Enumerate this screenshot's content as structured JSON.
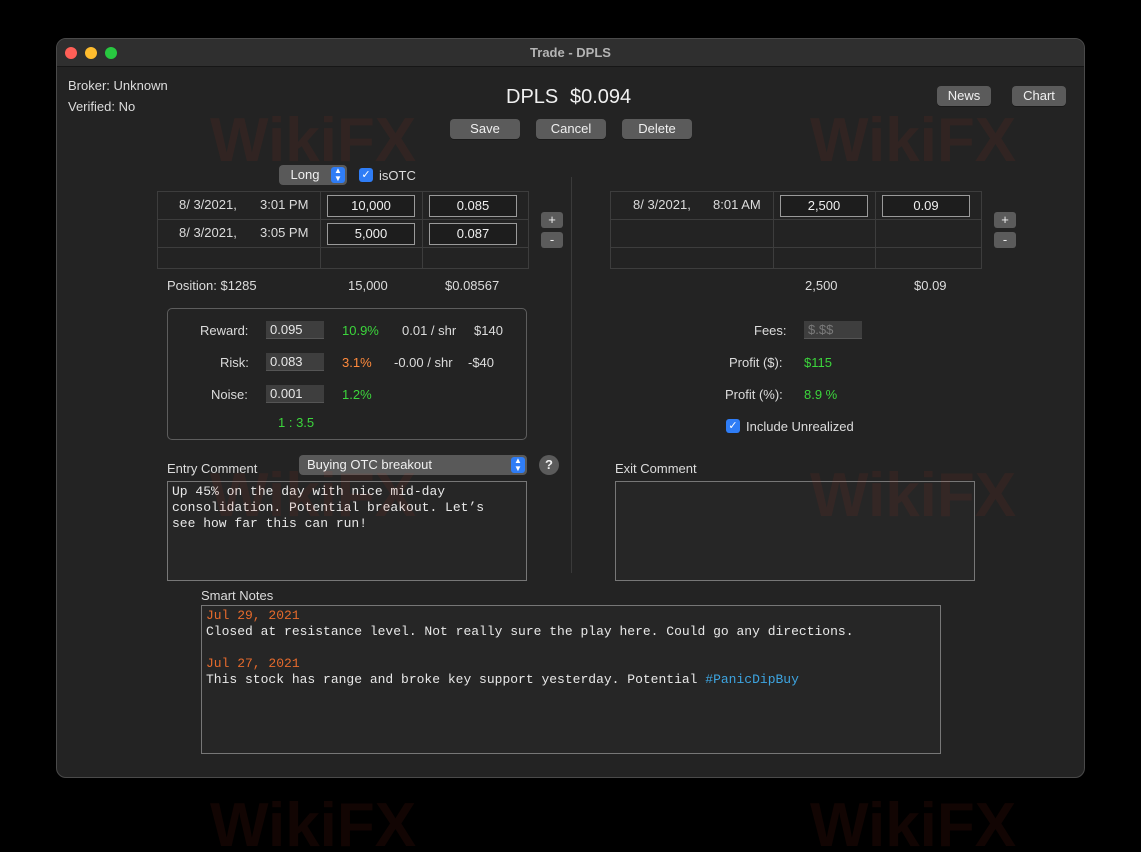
{
  "window": {
    "title": "Trade - DPLS"
  },
  "header": {
    "broker": "Broker: Unknown",
    "verified": "Verified: No",
    "symbol": "DPLS",
    "price": "$0.094",
    "save_label": "Save",
    "cancel_label": "Cancel",
    "delete_label": "Delete",
    "news_label": "News",
    "chart_label": "Chart"
  },
  "entry": {
    "direction": "Long",
    "isotc_label": "isOTC",
    "isotc_checked": true,
    "rows": [
      {
        "date": "8/  3/2021,",
        "time": "3:01 PM",
        "shares": "10,000",
        "price": "0.085"
      },
      {
        "date": "8/  3/2021,",
        "time": "3:05 PM",
        "shares": "5,000",
        "price": "0.087"
      }
    ],
    "position_label": "Position: $1285",
    "total_shares": "15,000",
    "avg_price": "$0.08567",
    "add_label": "+",
    "remove_label": "-"
  },
  "exit": {
    "rows": [
      {
        "date": "8/  3/2021,",
        "time": "8:01 AM",
        "shares": "2,500",
        "price": "0.09"
      }
    ],
    "total_shares": "2,500",
    "avg_price": "$0.09",
    "add_label": "+",
    "remove_label": "-"
  },
  "risk_panel": {
    "reward_label": "Reward:",
    "reward_value": "0.095",
    "reward_pct": "10.9%",
    "reward_per_share": "0.01 / shr",
    "reward_dollars": "$140",
    "risk_label": "Risk:",
    "risk_value": "0.083",
    "risk_pct": "3.1%",
    "risk_per_share": "-0.00 / shr",
    "risk_dollars": "-$40",
    "noise_label": "Noise:",
    "noise_value": "0.001",
    "noise_pct": "1.2%",
    "ratio": "1 : 3.5"
  },
  "results": {
    "fees_label": "Fees:",
    "fees_placeholder": "$.$$",
    "profit_dollars_label": "Profit ($):",
    "profit_dollars_value": "$115",
    "profit_pct_label": "Profit (%):",
    "profit_pct_value": "8.9 %",
    "include_unrealized_label": "Include Unrealized",
    "include_unrealized_checked": true
  },
  "comments": {
    "entry_label": "Entry Comment",
    "entry_preset": "Buying OTC breakout",
    "help_label": "?",
    "entry_text": "Up 45% on the day with nice mid-day\nconsolidation. Potential breakout. Let’s\nsee how far this can run!",
    "exit_label": "Exit Comment",
    "exit_text": ""
  },
  "smart_notes": {
    "label": "Smart Notes",
    "notes": [
      {
        "date": "Jul 29, 2021",
        "text": "Closed at resistance level. Not really sure the play here. Could go any directions."
      },
      {
        "date": "Jul 27, 2021",
        "text": "This stock has range and broke key support yesterday. Potential ",
        "hashtag": "#PanicDipBuy"
      }
    ]
  },
  "watermark": "WikiFX",
  "colors": {
    "window_bg": "#232323",
    "green": "#3cd53c",
    "orange": "#ff8a3c",
    "accent_blue": "#2f7df6",
    "hashtag_blue": "#3da4e0"
  }
}
